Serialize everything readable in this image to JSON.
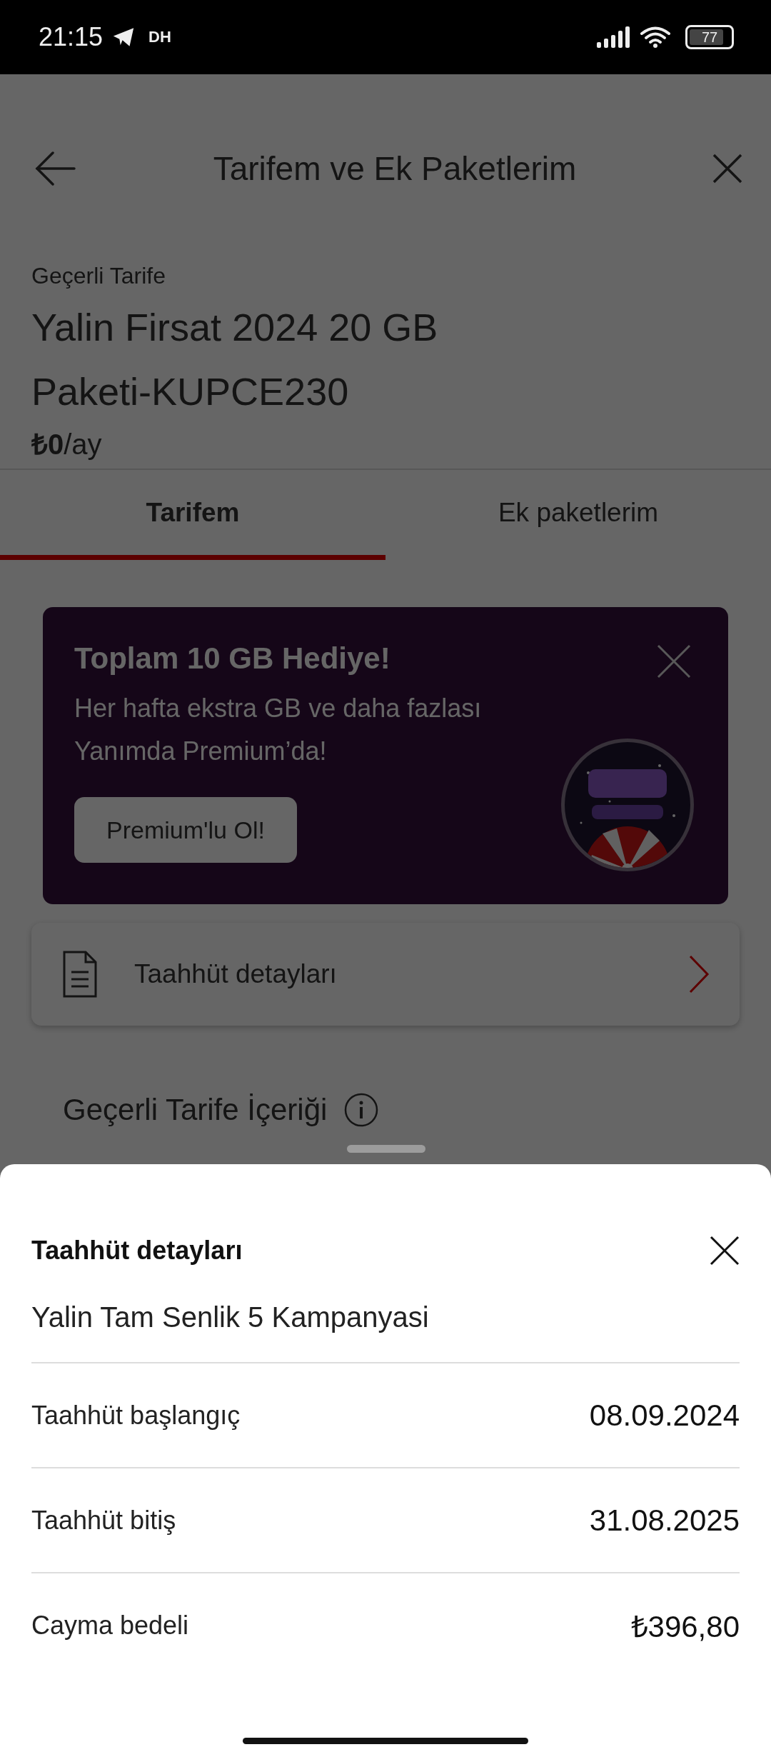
{
  "status_bar": {
    "time": "21:15",
    "carrier_badge": "DH",
    "battery": "77"
  },
  "header": {
    "title": "Tarifem ve Ek Paketlerim"
  },
  "tariff": {
    "label": "Geçerli Tarife",
    "name_lines": [
      "Yalin Firsat 2024 20 GB",
      "Paketi-KUPCE230"
    ],
    "price": "₺0",
    "period": "/ay"
  },
  "tabs": [
    {
      "label": "Tarifem",
      "selected": true
    },
    {
      "label": "Ek paketlerim",
      "selected": false
    }
  ],
  "promo": {
    "title": "Toplam 10 GB Hediye!",
    "text_lines": [
      "Her hafta ekstra GB ve daha fazlası",
      "Yanımda Premium’da!"
    ],
    "button": "Premium'lu Ol!",
    "image": {
      "kind": "picture"
    }
  },
  "commitment_row": {
    "label": "Taahhüt detayları"
  },
  "content_card": {
    "title": "Geçerli Tarife İçeriği"
  },
  "sheet": {
    "title": "Taahhüt detayları",
    "campaign": "Yalin Tam Senlik 5 Kampanyasi",
    "rows": [
      {
        "label": "Taahhüt başlangıç",
        "value": "08.09.2024"
      },
      {
        "label": "Taahhüt bitiş",
        "value": "31.08.2025"
      },
      {
        "label": "Cayma bedeli",
        "value": "₺396,80"
      }
    ]
  }
}
